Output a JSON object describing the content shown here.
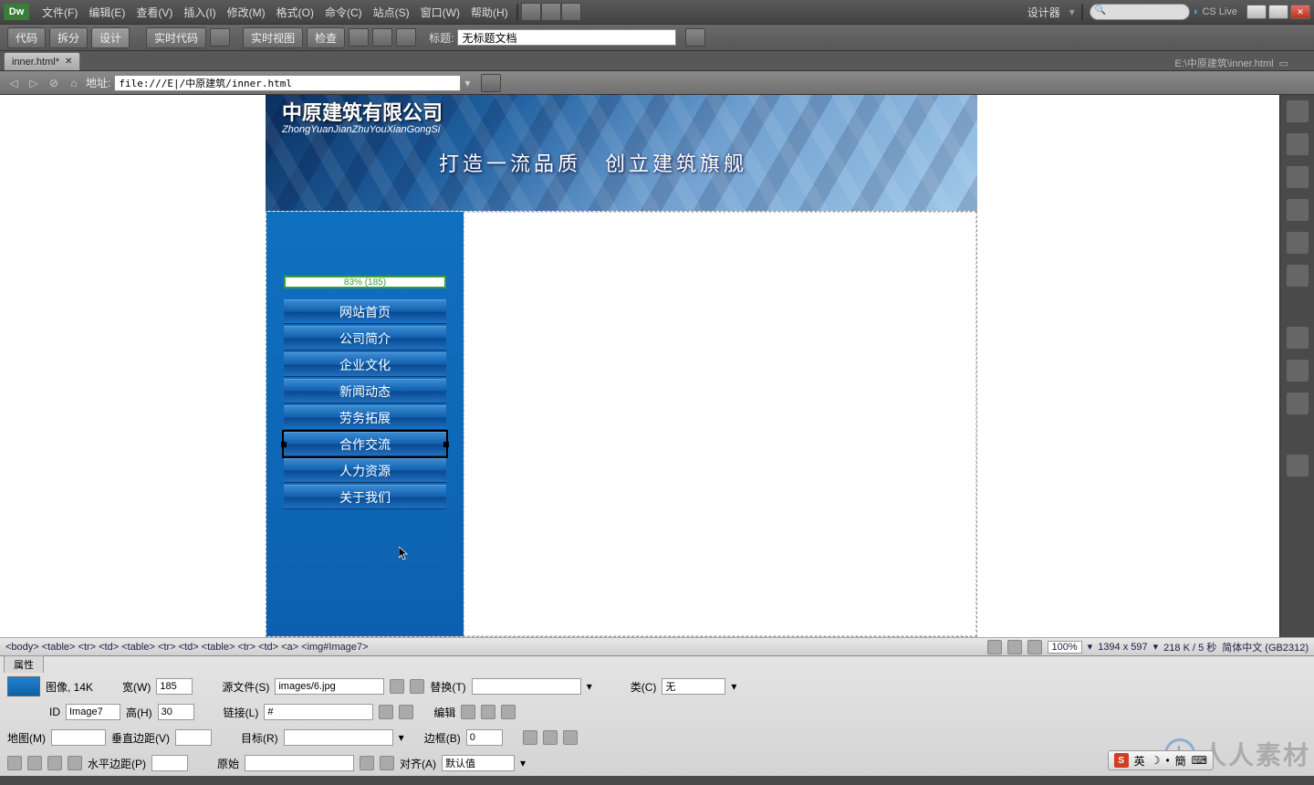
{
  "app": {
    "logo": "Dw"
  },
  "menu": [
    "文件(F)",
    "编辑(E)",
    "查看(V)",
    "插入(I)",
    "修改(M)",
    "格式(O)",
    "命令(C)",
    "站点(S)",
    "窗口(W)",
    "帮助(H)"
  ],
  "workspace": "设计器",
  "cslive": "CS Live",
  "toolbar": {
    "code": "代码",
    "split": "拆分",
    "design": "设计",
    "livecode": "实时代码",
    "liveview": "实时视图",
    "inspect": "检查",
    "title_label": "标题:",
    "title_value": "无标题文档"
  },
  "tab": {
    "name": "inner.html*",
    "path": "E:\\中原建筑\\inner.html"
  },
  "address": {
    "label": "地址:",
    "value": "file:///E|/中原建筑/inner.html"
  },
  "banner": {
    "company": "中原建筑有限公司",
    "pinyin": "ZhongYuanJianZhuYouXianGongSi",
    "slogan": "打造一流品质　创立建筑旗舰"
  },
  "pct": "83% (185)",
  "nav": [
    "网站首页",
    "公司简介",
    "企业文化",
    "新闻动态",
    "劳务拓展",
    "合作交流",
    "人力资源",
    "关于我们"
  ],
  "nav_selected": 5,
  "tagsel": "<body> <table> <tr> <td> <table> <tr> <td> <table> <tr> <td> <a> <img#Image7>",
  "status": {
    "zoom": "100%",
    "dims": "1394 x 597",
    "size": "218 K / 5 秒",
    "encoding": "简体中文 (GB2312)"
  },
  "props": {
    "panel": "属性",
    "type": "图像, 14K",
    "w_label": "宽(W)",
    "w": "185",
    "h_label": "高(H)",
    "h": "30",
    "id_label": "ID",
    "id": "Image7",
    "src_label": "源文件(S)",
    "src": "images/6.jpg",
    "link_label": "链接(L)",
    "link": "#",
    "alt_label": "替换(T)",
    "alt": "",
    "class_label": "类(C)",
    "class": "无",
    "edit_label": "编辑",
    "map_label": "地图(M)",
    "vspace_label": "垂直边距(V)",
    "hspace_label": "水平边距(P)",
    "target_label": "目标(R)",
    "orig_label": "原始",
    "border_label": "边框(B)",
    "border": "0",
    "align_label": "对齐(A)",
    "align": "默认值"
  },
  "ime": {
    "lang": "英",
    "mode": "簡"
  },
  "watermark": "人人素材"
}
